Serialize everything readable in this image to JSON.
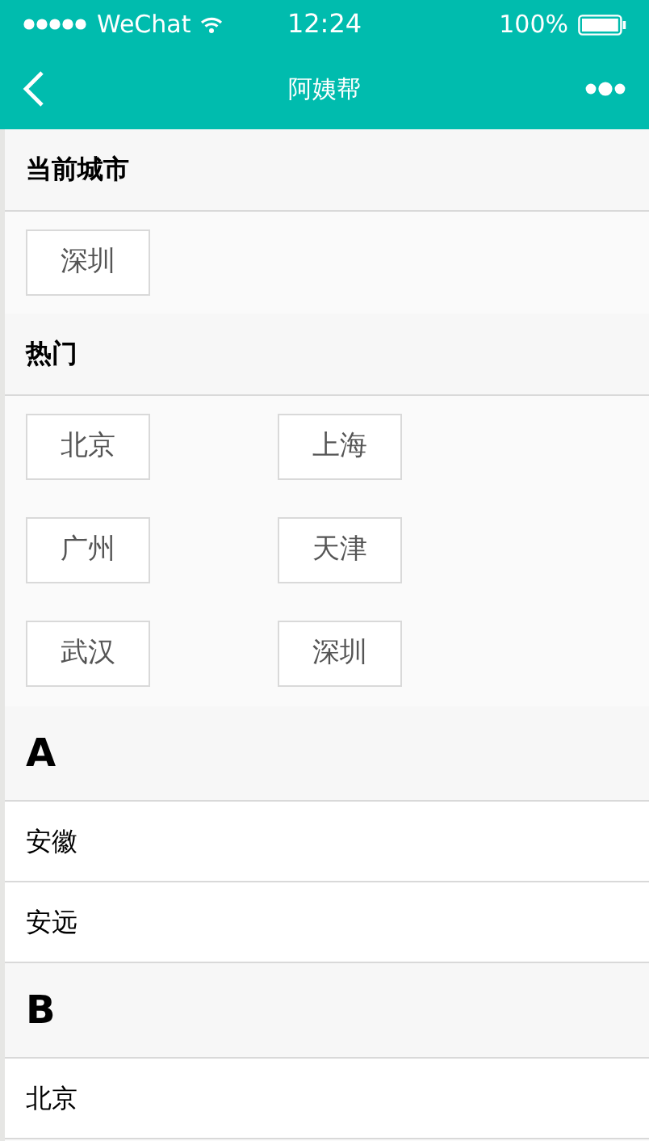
{
  "status_bar": {
    "carrier": "WeChat",
    "time": "12:24",
    "battery": "100%"
  },
  "nav": {
    "title": "阿姨帮"
  },
  "current_city": {
    "heading": "当前城市",
    "cities": [
      "深圳"
    ]
  },
  "hot": {
    "heading": "热门",
    "cities": [
      "北京",
      "上海",
      "广州",
      "天津",
      "武汉",
      "深圳"
    ]
  },
  "groups": [
    {
      "letter": "A",
      "cities": [
        "安徽",
        "安远"
      ]
    },
    {
      "letter": "B",
      "cities": [
        "北京"
      ]
    }
  ]
}
